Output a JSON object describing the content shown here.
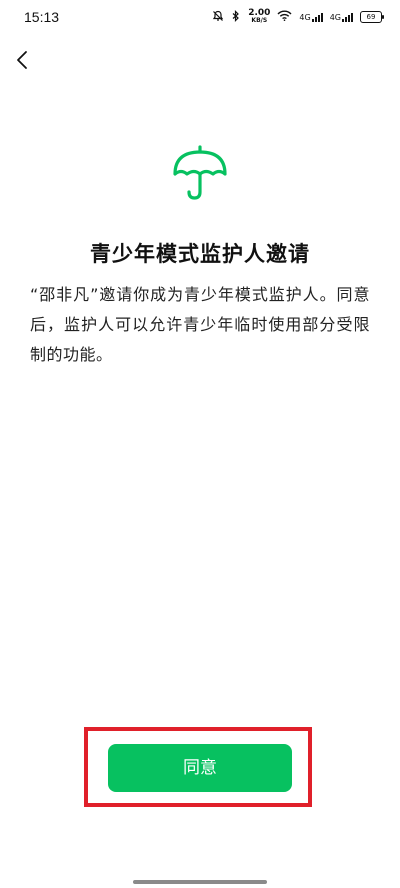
{
  "status_bar": {
    "time": "15:13",
    "net_speed_value": "2.00",
    "net_speed_unit": "KB/S",
    "signal1_label": "4G",
    "signal2_label": "4G",
    "battery_level": "69"
  },
  "header": {
    "back_icon": "chevron-left-icon"
  },
  "content": {
    "icon": "umbrella-icon",
    "icon_color": "#07c160",
    "title": "青少年模式监护人邀请",
    "description": "“邵非凡”邀请你成为青少年模式监护人。同意后，监护人可以允许青少年临时使用部分受限制的功能。"
  },
  "actions": {
    "agree_label": "同意",
    "agree_color": "#07c160",
    "highlight_color": "#e0202a"
  }
}
